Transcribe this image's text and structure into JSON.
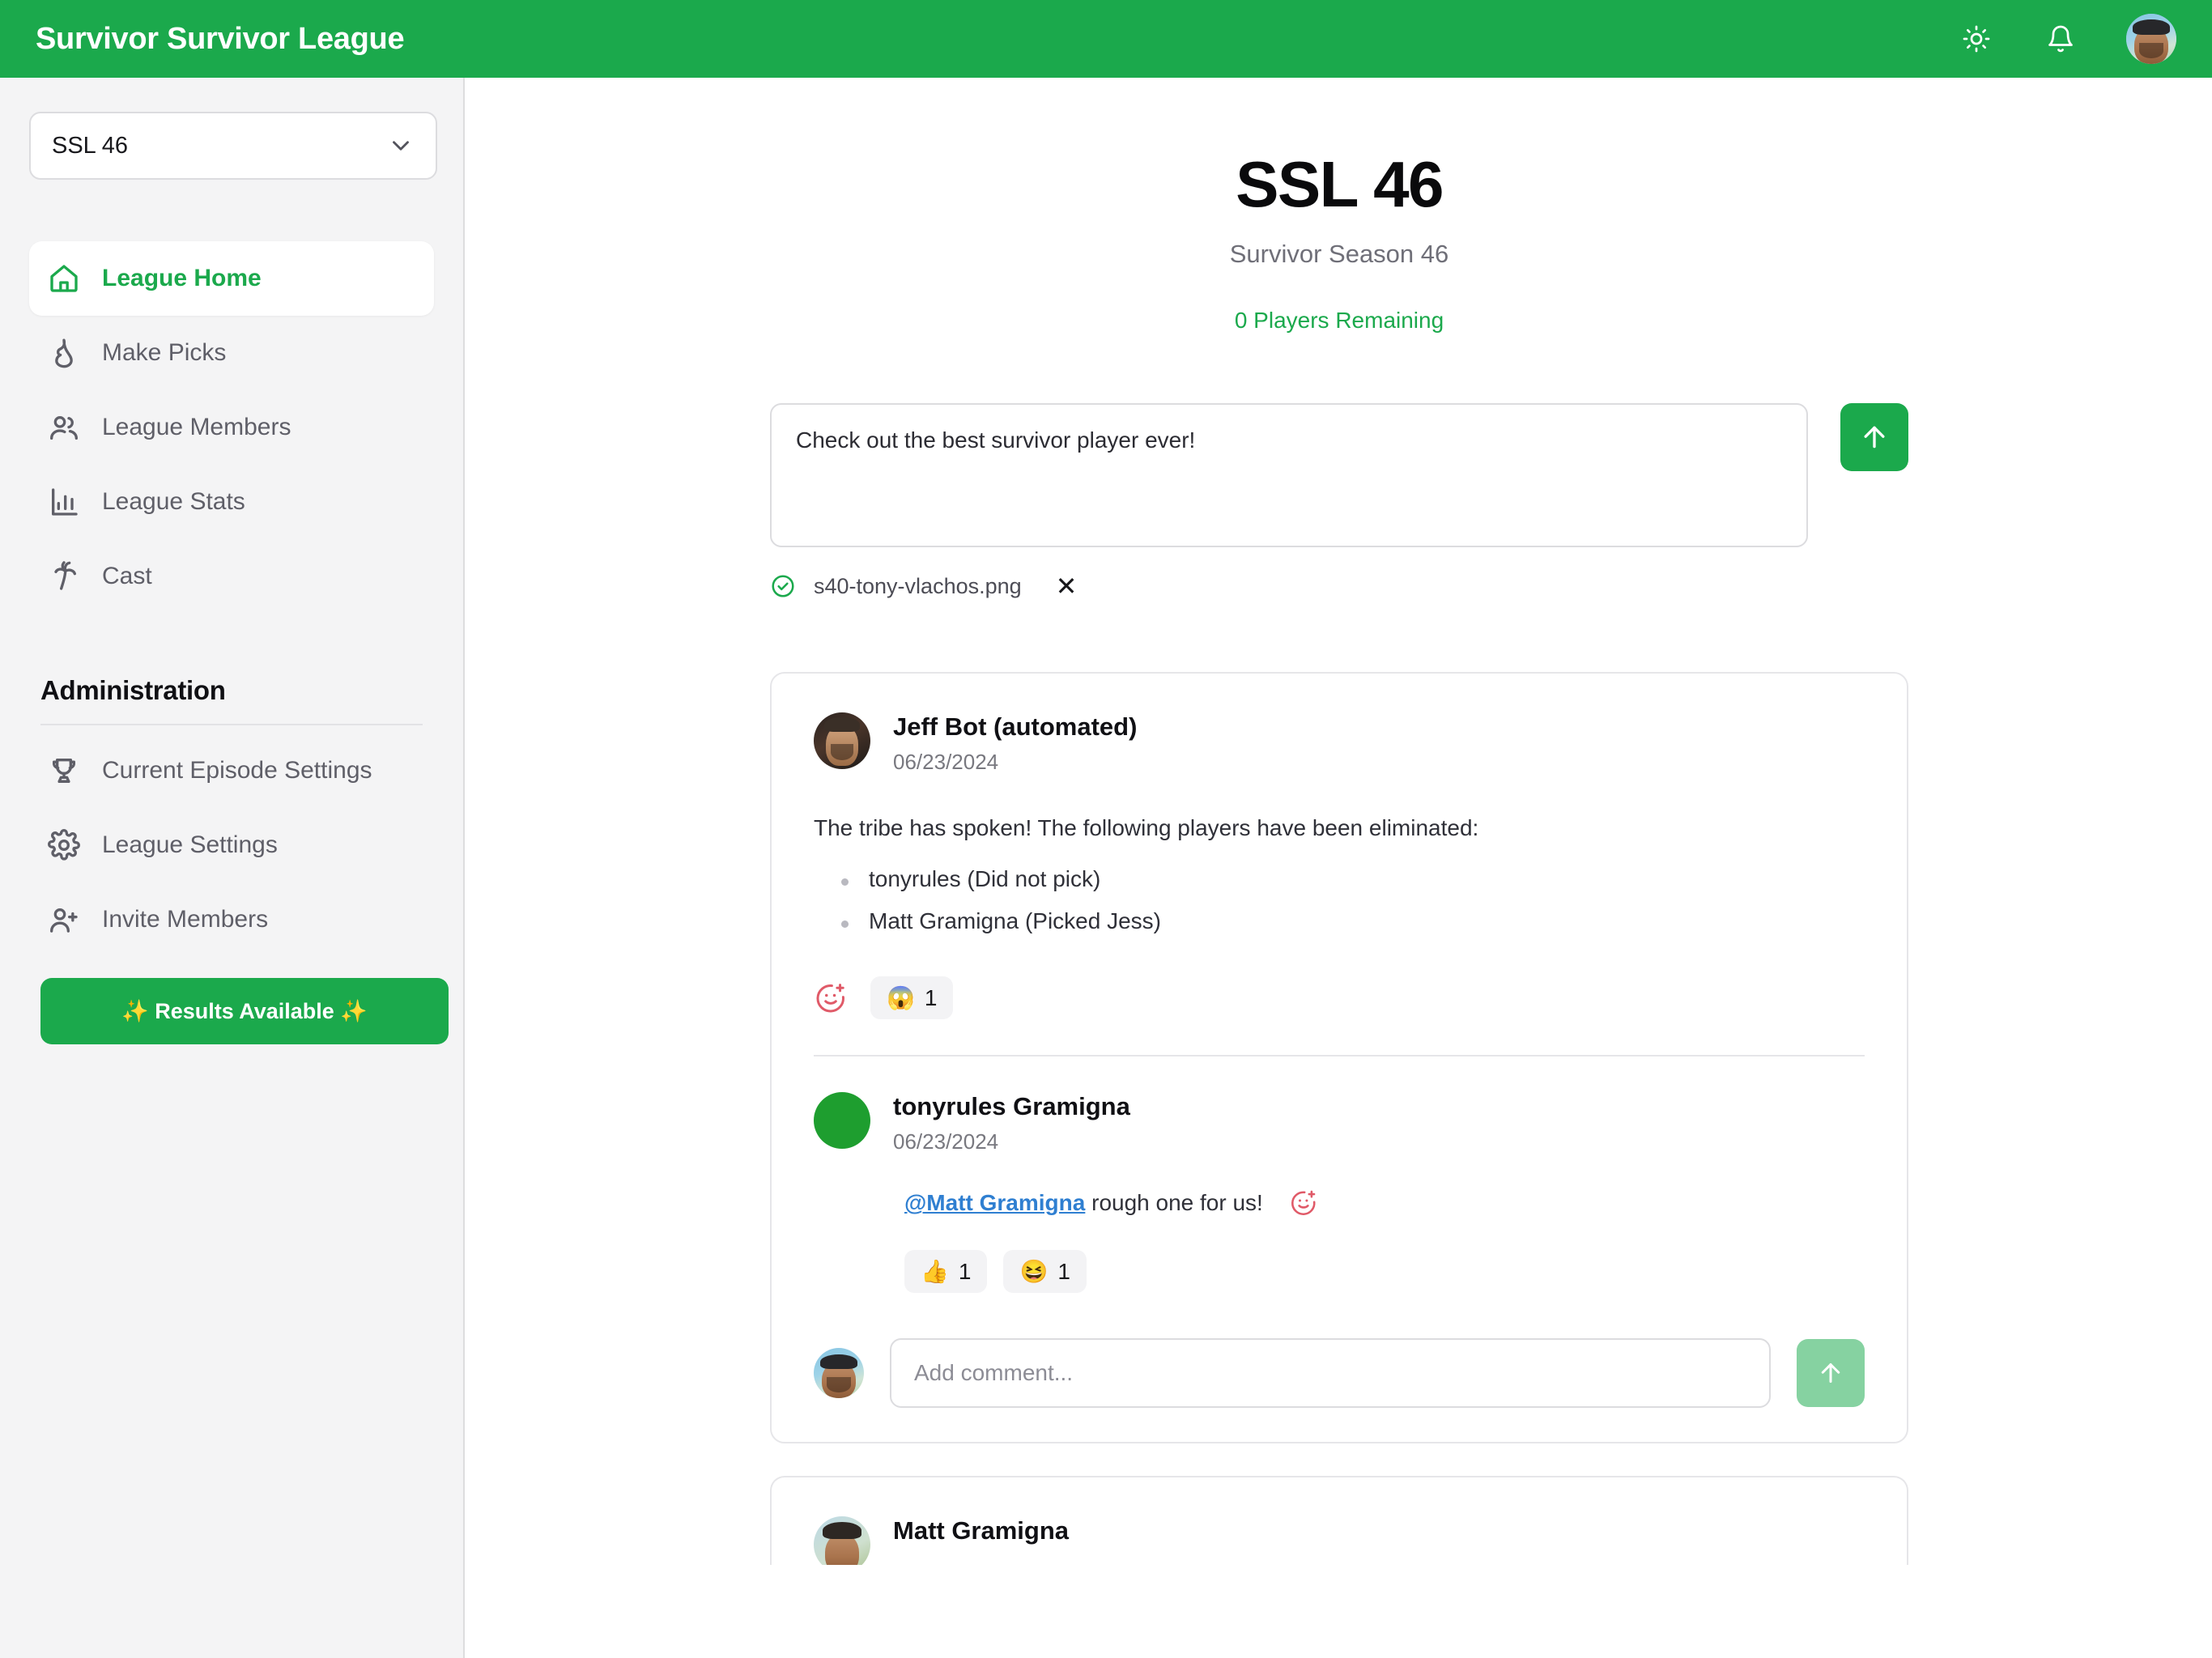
{
  "topbar": {
    "brand": "Survivor Survivor League",
    "theme_icon": "sun-icon",
    "notification_icon": "bell-icon",
    "avatar_icon": "user-avatar",
    "accent_color": "#1BA94C"
  },
  "sidebar": {
    "league_selector": {
      "value": "SSL 46",
      "chevron_icon": "chevron-down-icon"
    },
    "nav": [
      {
        "label": "League Home",
        "icon": "home-icon",
        "active": true
      },
      {
        "label": "Make Picks",
        "icon": "flame-icon",
        "active": false
      },
      {
        "label": "League Members",
        "icon": "users-icon",
        "active": false
      },
      {
        "label": "League Stats",
        "icon": "chart-bar-icon",
        "active": false
      },
      {
        "label": "Cast",
        "icon": "palm-tree-icon",
        "active": false
      }
    ],
    "admin_heading": "Administration",
    "admin_nav": [
      {
        "label": "Current Episode Settings",
        "icon": "trophy-icon"
      },
      {
        "label": "League Settings",
        "icon": "gear-icon"
      },
      {
        "label": "Invite Members",
        "icon": "user-plus-icon"
      }
    ],
    "results_button": "✨ Results Available ✨"
  },
  "main": {
    "title": "SSL 46",
    "subtitle": "Survivor Season 46",
    "players_remaining": "0 Players Remaining",
    "composer": {
      "value": "Check out the best survivor player ever!",
      "placeholder": "",
      "send_icon": "arrow-up-icon"
    },
    "attachment": {
      "status_icon": "check-circle-icon",
      "filename": "s40-tony-vlachos.png",
      "remove_icon": "close-icon",
      "remove_label": "✕"
    },
    "posts": [
      {
        "author": "Jeff Bot (automated)",
        "date": "06/23/2024",
        "avatar": "jeff-bot-avatar",
        "body": "The tribe has spoken! The following players have been eliminated:",
        "eliminated": [
          "tonyrules  (Did not pick)",
          "Matt Gramigna (Picked Jess)"
        ],
        "add_reaction_icon": "add-reaction-icon",
        "reactions": [
          {
            "emoji": "😱",
            "count": "1"
          }
        ],
        "comment": {
          "author": "tonyrules Gramigna",
          "date": "06/23/2024",
          "avatar": "green-circle-avatar",
          "mention": "@Matt Gramigna",
          "text": " rough one for us!",
          "add_reaction_icon": "add-reaction-icon",
          "reactions": [
            {
              "emoji": "👍",
              "count": "1"
            },
            {
              "emoji": "😆",
              "count": "1"
            }
          ]
        },
        "add_comment": {
          "placeholder": "Add comment...",
          "avatar": "user-avatar",
          "send_icon": "arrow-up-icon"
        }
      },
      {
        "author": "Matt Gramigna",
        "avatar": "matt-gramigna-avatar"
      }
    ]
  }
}
